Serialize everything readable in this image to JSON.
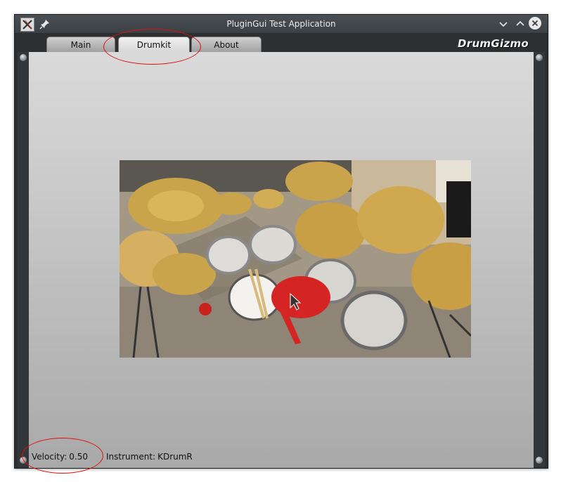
{
  "window": {
    "title": "PluginGui Test Application",
    "icons": {
      "app": "x-app-icon",
      "pin": "pin-icon",
      "minimize": "chevron-down-icon",
      "maximize": "chevron-up-icon",
      "close": "close-icon"
    }
  },
  "tabs": [
    {
      "label": "Main",
      "selected": false
    },
    {
      "label": "Drumkit",
      "selected": true
    },
    {
      "label": "About",
      "selected": false
    }
  ],
  "brand": {
    "text": "DrumGizmo"
  },
  "drumkit": {
    "image_description_icon": "drumkit-photo",
    "highlighted_instrument_color": "#d42424"
  },
  "status": {
    "velocity_label": "Velocity:",
    "velocity_value": "0.50",
    "instrument_label": "Instrument:",
    "instrument_value": "KDrumR"
  },
  "annotation_color": "#e01010"
}
